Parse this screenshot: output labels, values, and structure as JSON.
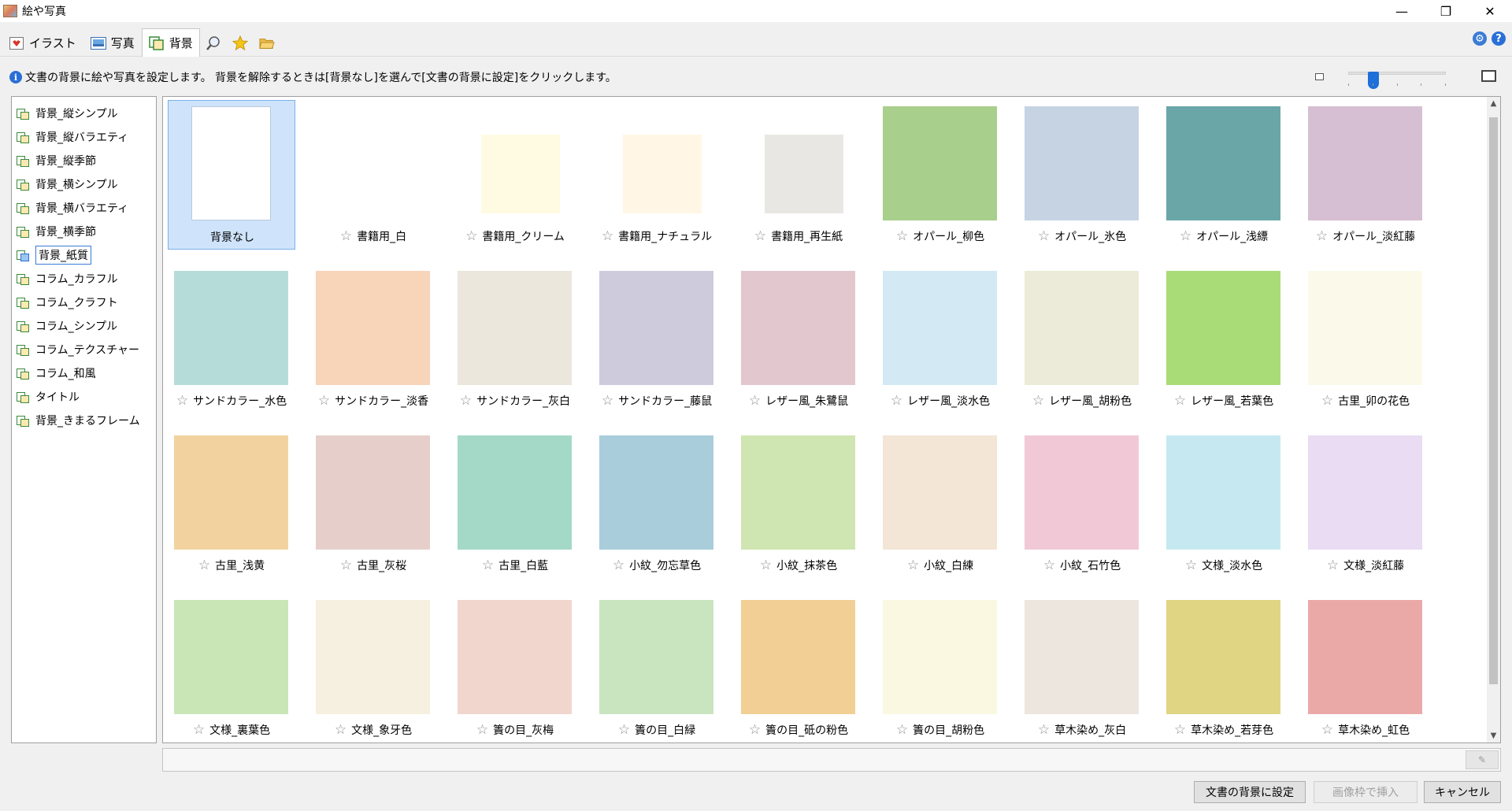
{
  "window": {
    "title": "絵や写真",
    "minimize": "—",
    "maximize": "❐",
    "close": "✕"
  },
  "tabs": [
    {
      "label": "イラスト",
      "icon": "illustration-icon"
    },
    {
      "label": "写真",
      "icon": "photo-icon"
    },
    {
      "label": "背景",
      "icon": "background-icon",
      "active": true
    },
    {
      "label": "",
      "icon": "search-icon"
    },
    {
      "label": "",
      "icon": "star-icon"
    },
    {
      "label": "",
      "icon": "folder-icon"
    }
  ],
  "info": {
    "text": "文書の背景に絵や写真を設定します。 背景を解除するときは[背景なし]を選んで[文書の背景に設定]をクリックします。"
  },
  "zoom": {
    "level": 0.25
  },
  "tree": {
    "items": [
      {
        "label": "背景_縦シンプル"
      },
      {
        "label": "背景_縦バラエティ"
      },
      {
        "label": "背景_縦季節"
      },
      {
        "label": "背景_横シンプル"
      },
      {
        "label": "背景_横バラエティ"
      },
      {
        "label": "背景_横季節"
      },
      {
        "label": "背景_紙質",
        "selected": true
      },
      {
        "label": "コラム_カラフル"
      },
      {
        "label": "コラム_クラフト"
      },
      {
        "label": "コラム_シンプル"
      },
      {
        "label": "コラム_テクスチャー"
      },
      {
        "label": "コラム_和風"
      },
      {
        "label": "タイトル"
      },
      {
        "label": "背景_きまるフレーム"
      }
    ]
  },
  "gallery": {
    "items": [
      {
        "label": "背景なし",
        "color": "#ffffff",
        "type": "none"
      },
      {
        "label": "書籍用_白",
        "color": "#ffffff",
        "type": "small"
      },
      {
        "label": "書籍用_クリーム",
        "color": "#fffbe3",
        "type": "small"
      },
      {
        "label": "書籍用_ナチュラル",
        "color": "#fff6e6",
        "type": "small"
      },
      {
        "label": "書籍用_再生紙",
        "color": "#e9e7e3",
        "type": "small"
      },
      {
        "label": "オパール_柳色",
        "color": "#a8cf8c"
      },
      {
        "label": "オパール_氷色",
        "color": "#c6d3e3"
      },
      {
        "label": "オパール_浅縹",
        "color": "#6aa6a8"
      },
      {
        "label": "オパール_淡紅藤",
        "color": "#d6bfd2"
      },
      {
        "label": "サンドカラー_水色",
        "color": "#b6dcd9"
      },
      {
        "label": "サンドカラー_淡香",
        "color": "#f8d4b9"
      },
      {
        "label": "サンドカラー_灰白",
        "color": "#ebe7dc"
      },
      {
        "label": "サンドカラー_藤鼠",
        "color": "#cdcbdc"
      },
      {
        "label": "レザー風_朱鷺鼠",
        "color": "#e3c7cf"
      },
      {
        "label": "レザー風_淡水色",
        "color": "#d3e9f3"
      },
      {
        "label": "レザー風_胡粉色",
        "color": "#ecebd9"
      },
      {
        "label": "レザー風_若葉色",
        "color": "#a9dc76"
      },
      {
        "label": "古里_卯の花色",
        "color": "#fbf9ea"
      },
      {
        "label": "古里_浅黄",
        "color": "#f2d3a0"
      },
      {
        "label": "古里_灰桜",
        "color": "#e6cfcb"
      },
      {
        "label": "古里_白藍",
        "color": "#a4d8c7"
      },
      {
        "label": "小紋_勿忘草色",
        "color": "#a9cddb"
      },
      {
        "label": "小紋_抹茶色",
        "color": "#cfe5b2"
      },
      {
        "label": "小紋_白練",
        "color": "#f3e6d6"
      },
      {
        "label": "小紋_石竹色",
        "color": "#f1c9d6"
      },
      {
        "label": "文様_淡水色",
        "color": "#c6e9f1"
      },
      {
        "label": "文様_淡紅藤",
        "color": "#e9dcf3"
      },
      {
        "label": "文様_裏葉色",
        "color": "#c9e6b7"
      },
      {
        "label": "文様_象牙色",
        "color": "#f5f0df"
      },
      {
        "label": "簀の目_灰梅",
        "color": "#f0d6cd"
      },
      {
        "label": "簀の目_白緑",
        "color": "#c8e5c0"
      },
      {
        "label": "簀の目_砥の粉色",
        "color": "#f2cf95"
      },
      {
        "label": "簀の目_胡粉色",
        "color": "#fbf8e2"
      },
      {
        "label": "草木染め_灰白",
        "color": "#ece6de"
      },
      {
        "label": "草木染め_若芽色",
        "color": "#dfd583"
      },
      {
        "label": "草木染め_虹色",
        "color": "#eaa9a7"
      }
    ]
  },
  "buttons": {
    "set_background": "文書の背景に設定",
    "insert_frame": "画像枠で挿入",
    "cancel": "キャンセル"
  }
}
